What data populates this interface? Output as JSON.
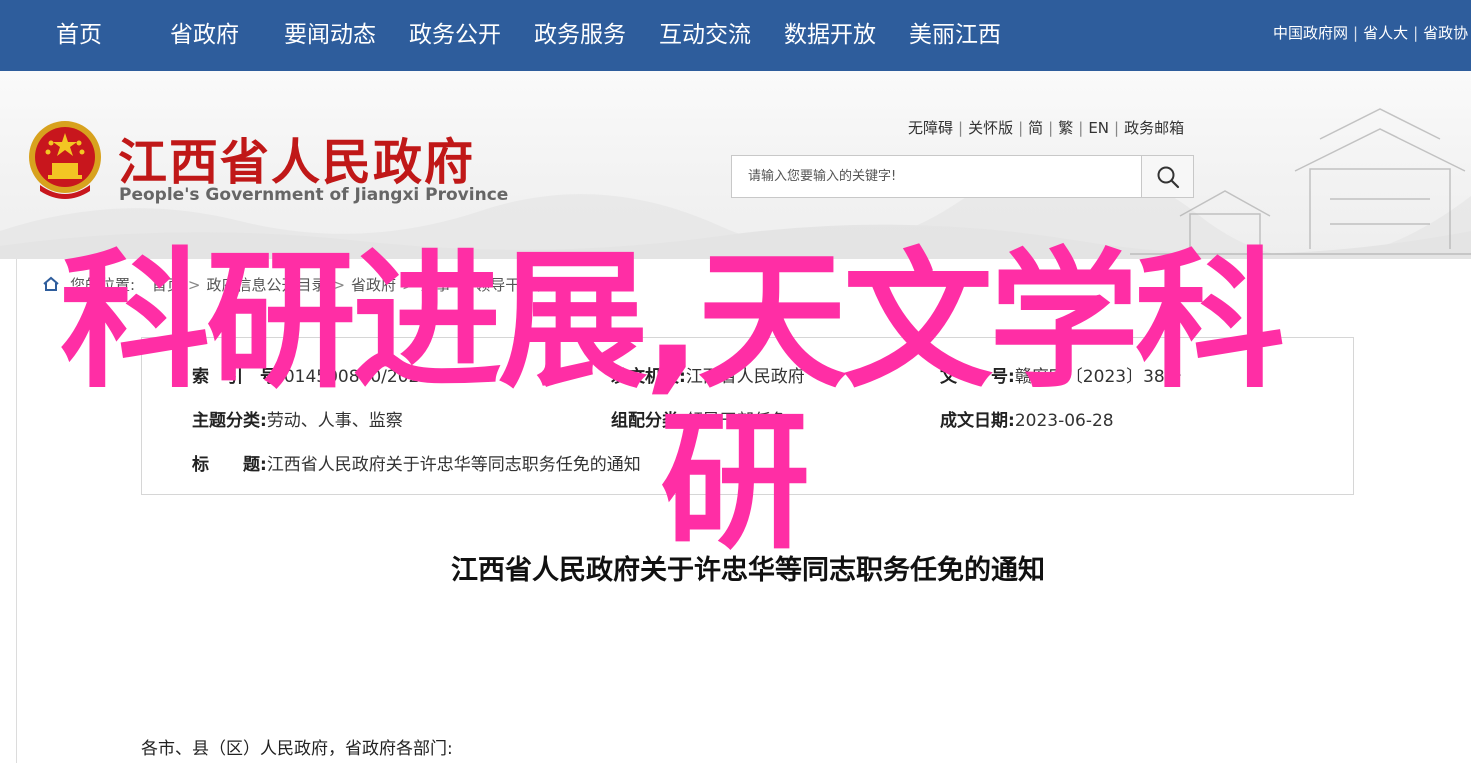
{
  "nav": {
    "items": [
      "首页",
      "省政府",
      "要闻动态",
      "政务公开",
      "政务服务",
      "互动交流",
      "数据开放",
      "美丽江西"
    ],
    "top_links": [
      "中国政府网",
      "省人大",
      "省政协"
    ]
  },
  "header": {
    "title": "江西省人民政府",
    "subtitle": "People's Government of Jiangxi Province",
    "util_links": [
      "无障碍",
      "关怀版",
      "简",
      "繁",
      "EN",
      "政务邮箱"
    ]
  },
  "search": {
    "placeholder": "请输入您要输入的关键字!"
  },
  "breadcrumb": [
    "您的位置:",
    "首页",
    "政府信息公开目录",
    "省政府",
    "人事",
    "领导干部任免"
  ],
  "meta": {
    "index_label": "索　引　号:",
    "index_value": "014500810/2023-75732",
    "issuer_label": "发文机关:",
    "issuer_value": "江西省人民政府",
    "doc_no_label": "文　　号:",
    "doc_no_value": "赣府字〔2023〕38号",
    "category_label": "主题分类:",
    "category_value": "劳动、人事、监察",
    "compiler_label": "组配分类:",
    "compiler_value": "领导干部任免",
    "date_label": "成文日期:",
    "date_value": "2023-06-28",
    "subject_label": "标　　题:",
    "subject_value": "江西省人民政府关于许忠华等同志职务任免的通知"
  },
  "document": {
    "title": "江西省人民政府关于许忠华等同志职务任免的通知",
    "salutation": "各市、县（区）人民政府，省政府各部门:"
  },
  "overlay": {
    "line1": "科研进展,天文学科",
    "line2": "研"
  },
  "colors": {
    "nav_bg": "#2e5d9c",
    "brand_red": "#c01818",
    "overlay_pink": "#ff2ea5"
  }
}
